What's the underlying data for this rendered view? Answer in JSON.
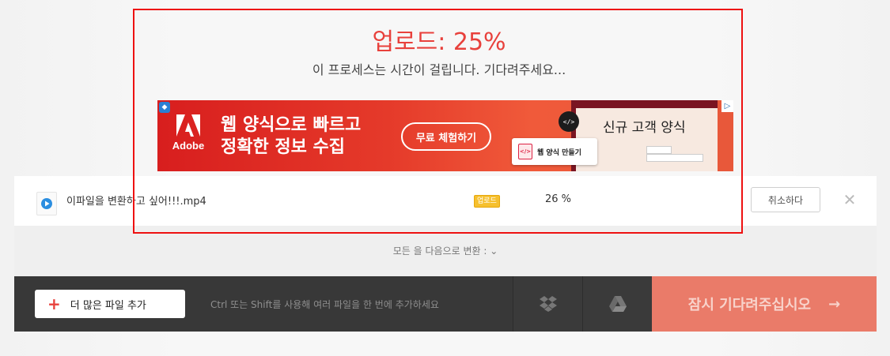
{
  "upload": {
    "title": "업로드: 25%",
    "subtitle": "이 프로세스는 시간이 걸립니다. 기다려주세요..."
  },
  "ad": {
    "brand": "Adobe",
    "headline_line1": "웹 양식으로 빠르고",
    "headline_line2": "정확한 정보 수집",
    "cta": "무료 체험하기",
    "form_title": "신규 고객 양식",
    "make_form_label": "웹 양식 만들기",
    "code_badge": "</>",
    "choices_icon": "adchoices-icon",
    "privacy_icon": "privacy-shield-icon"
  },
  "file": {
    "name": "이파일을 변환하고 싶어!!!.mp4",
    "status": "업로드",
    "percent": "26 %",
    "progress_fraction": 0.26,
    "cancel_label": "취소하다"
  },
  "convert": {
    "label": "모든 을 다음으로 변환 :"
  },
  "bottom": {
    "add_label": "더 많은 파일 추가",
    "hint": "Ctrl 또는 Shift를 사용해 여러 파일을 한 번에 추가하세요",
    "wait_label": "잠시 기다려주십시오"
  },
  "colors": {
    "accent": "#e8413c",
    "status_badge": "#f6c02e",
    "bottom_bar": "#383838",
    "wait_button": "#ea7b69"
  }
}
